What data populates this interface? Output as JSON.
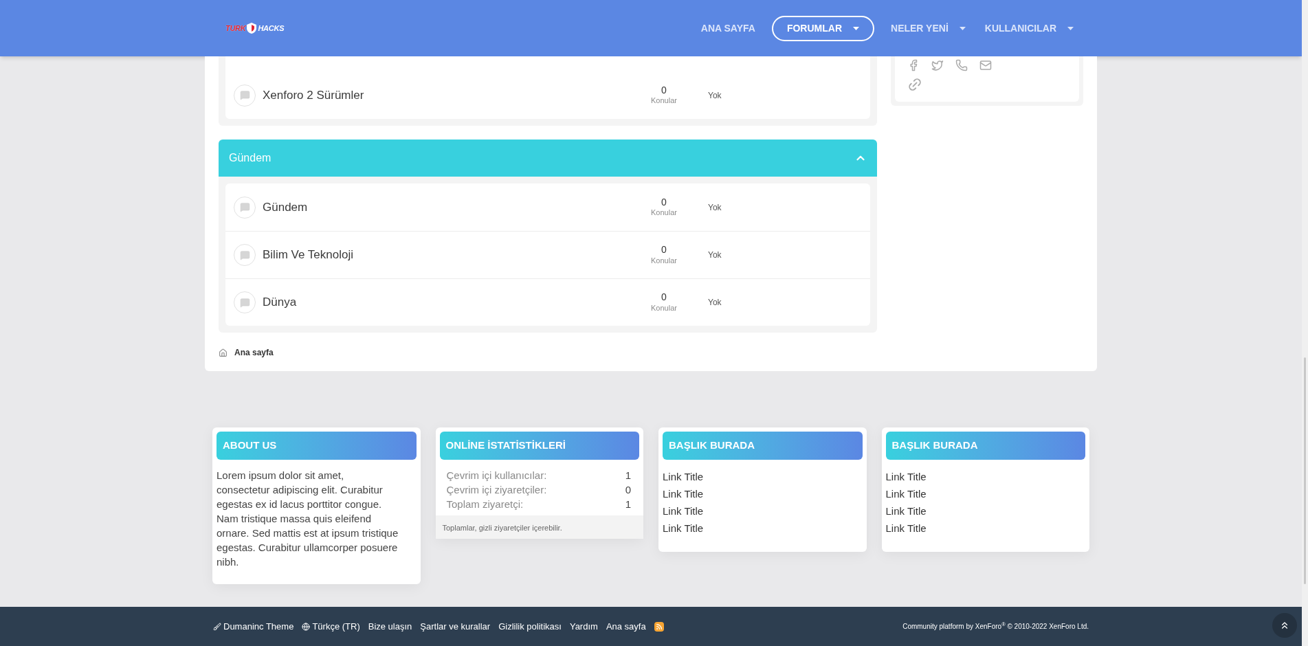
{
  "header": {
    "logo": {
      "part1": "TURK",
      "part2": "HACKS"
    },
    "nav": [
      {
        "label": "ANA SAYFA",
        "selected": false,
        "has_menu": false
      },
      {
        "label": "FORUMLAR",
        "selected": true,
        "has_menu": true
      },
      {
        "label": "NELER YENİ",
        "selected": false,
        "has_menu": true
      },
      {
        "label": "KULLANICILAR",
        "selected": false,
        "has_menu": true
      }
    ]
  },
  "categories": [
    {
      "forums": [
        {
          "name": "Xenforo 2 Sürümler",
          "count": "0",
          "count_label": "Konular",
          "last": "Yok"
        }
      ]
    },
    {
      "title": "Gündem",
      "expanded": true,
      "forums": [
        {
          "name": "Gündem",
          "count": "0",
          "count_label": "Konular",
          "last": "Yok"
        },
        {
          "name": "Bilim Ve Teknoloji",
          "count": "0",
          "count_label": "Konular",
          "last": "Yok"
        },
        {
          "name": "Dünya",
          "count": "0",
          "count_label": "Konular",
          "last": "Yok"
        }
      ]
    }
  ],
  "breadcrumb": "Ana sayfa",
  "footer_widgets": [
    {
      "kind": "text",
      "title": "ABOUT US",
      "text": "Lorem ipsum dolor sit amet, consectetur adipiscing elit. Curabitur egestas ex id lacus porttitor congue. Nam tristique massa quis eleifend ornare. Sed mattis est at ipsum tristique egestas. Curabitur ullamcorper posuere nibh."
    },
    {
      "kind": "stats",
      "title": "ONLİNE İSTATİSTİKLERİ",
      "stats": [
        {
          "label": "Çevrim içi kullanıcılar:",
          "value": "1"
        },
        {
          "label": "Çevrim içi ziyaretçiler:",
          "value": "0"
        },
        {
          "label": "Toplam ziyaretçi:",
          "value": "1"
        }
      ],
      "note": "Toplamlar, gizli ziyaretçiler içerebilir."
    },
    {
      "kind": "links",
      "title": "BAŞLIK BURADA",
      "links": [
        "Link Title",
        "Link Title",
        "Link Title",
        "Link Title"
      ]
    },
    {
      "kind": "links",
      "title": "BAŞLIK BURADA",
      "links": [
        "Link Title",
        "Link Title",
        "Link Title",
        "Link Title"
      ]
    }
  ],
  "footer": {
    "links": [
      {
        "kind": "theme",
        "label": "Dumaninc Theme"
      },
      {
        "kind": "language",
        "label": "Türkçe (TR)"
      },
      {
        "kind": "plain",
        "label": "Bize ulaşın"
      },
      {
        "kind": "plain",
        "label": "Şartlar ve kurallar"
      },
      {
        "kind": "plain",
        "label": "Gizlilik politikası"
      },
      {
        "kind": "plain",
        "label": "Yardım"
      },
      {
        "kind": "plain",
        "label": "Ana sayfa"
      },
      {
        "kind": "rss"
      }
    ],
    "copyright": "Community platform by XenForo$^{®}$ © 2010-2022 XenForo Ltd."
  }
}
